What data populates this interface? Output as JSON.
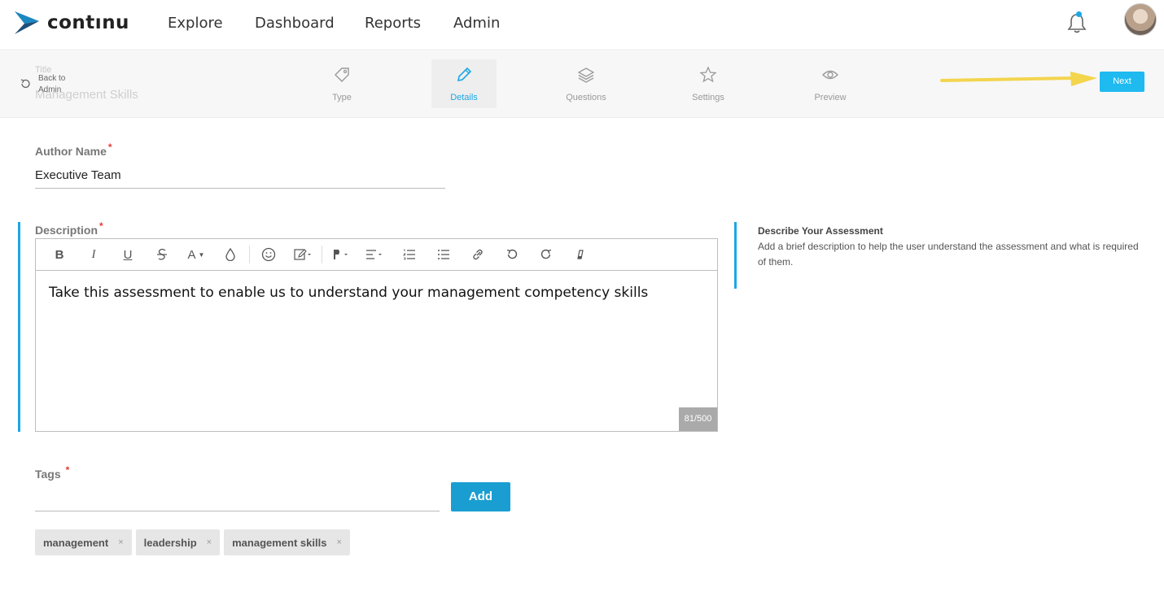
{
  "app": {
    "brand": "contınu"
  },
  "nav": {
    "items": [
      "Explore",
      "Dashboard",
      "Reports",
      "Admin"
    ]
  },
  "stepbar": {
    "back_label": "Back to Admin",
    "ghost_title": "Title",
    "ghost_value": "Management Skills",
    "steps": [
      {
        "label": "Type",
        "icon": "tag-icon",
        "active": false
      },
      {
        "label": "Details",
        "icon": "pencil-icon",
        "active": true
      },
      {
        "label": "Questions",
        "icon": "layers-icon",
        "active": false
      },
      {
        "label": "Settings",
        "icon": "star-icon",
        "active": false
      },
      {
        "label": "Preview",
        "icon": "eye-icon",
        "active": false
      }
    ],
    "next_label": "Next"
  },
  "author": {
    "label": "Author Name",
    "required_mark": "*",
    "value": "Executive Team"
  },
  "description": {
    "label": "Description",
    "required_mark": "*",
    "text": "Take this assessment to enable us to understand your management competency skills",
    "counter": "81/500",
    "toolbar": [
      "bold",
      "italic",
      "underline",
      "strikethrough",
      "font-color",
      "color-fill",
      "emoji",
      "edit",
      "paragraph",
      "align",
      "ordered-list",
      "unordered-list",
      "link",
      "undo",
      "redo",
      "clear-format"
    ]
  },
  "help": {
    "title": "Describe Your Assessment",
    "text": "Add a brief description to help the user understand the assessment and what is required of them."
  },
  "tags": {
    "label": "Tags",
    "required_mark": "*",
    "input_value": "",
    "add_label": "Add",
    "items": [
      "management",
      "leadership",
      "management skills"
    ],
    "remove_glyph": "×"
  },
  "colors": {
    "accent": "#1aa7e6",
    "next_button": "#1ebaf0",
    "add_button": "#1a9ed1",
    "annotation_arrow": "#f3d54e"
  }
}
